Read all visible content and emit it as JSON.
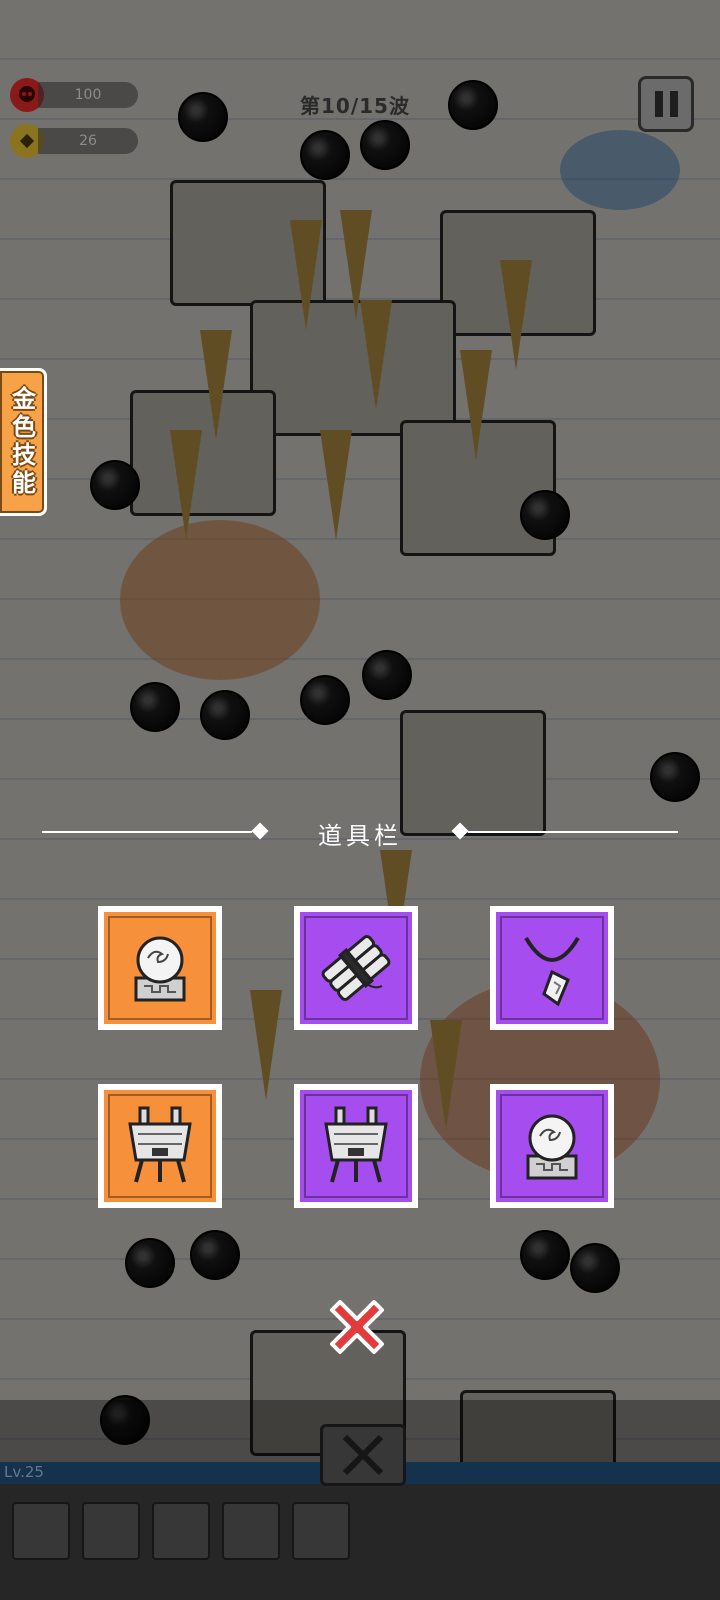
{
  "hud": {
    "health_value": "100",
    "gold_value": "26",
    "wave_label": "第10/15波"
  },
  "side": {
    "gold_skill_label": "金色技能"
  },
  "inventory": {
    "title": "道具栏",
    "items": [
      {
        "rarity": "orange",
        "icon": "crystal-ball-icon"
      },
      {
        "rarity": "purple",
        "icon": "dynamite-bundle-icon"
      },
      {
        "rarity": "purple",
        "icon": "pendant-necklace-icon"
      },
      {
        "rarity": "orange",
        "icon": "bronze-cauldron-icon"
      },
      {
        "rarity": "purple",
        "icon": "bronze-cauldron-icon"
      },
      {
        "rarity": "purple",
        "icon": "crystal-ball-icon"
      }
    ]
  },
  "bottom": {
    "level_label": "Lv.25"
  },
  "colors": {
    "orange_slot": "#f7903a",
    "purple_slot": "#a64df0",
    "close_red": "#e23b3b",
    "gold_skill": "#f7a247"
  }
}
